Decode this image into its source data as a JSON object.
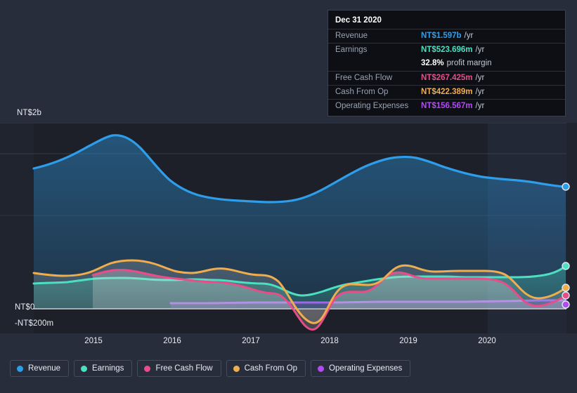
{
  "axes": {
    "y_top_label": "NT$2b",
    "y_zero_label": "NT$0",
    "y_neg_label": "-NT$200m",
    "x_labels": [
      "2015",
      "2016",
      "2017",
      "2018",
      "2019",
      "2020"
    ]
  },
  "tooltip": {
    "title": "Dec 31 2020",
    "rows": [
      {
        "key": "Revenue",
        "value": "NT$1.597b",
        "unit": "/yr",
        "color": "#2e9eeb"
      },
      {
        "key": "Earnings",
        "value": "NT$523.696m",
        "unit": "/yr",
        "color": "#4be0c0"
      },
      {
        "key": "",
        "value": "32.8%",
        "unit": "profit margin",
        "color": "#ffffff"
      },
      {
        "key": "Free Cash Flow",
        "value": "NT$267.425m",
        "unit": "/yr",
        "color": "#e84d8a"
      },
      {
        "key": "Cash From Op",
        "value": "NT$422.389m",
        "unit": "/yr",
        "color": "#f0ad4e"
      },
      {
        "key": "Operating Expenses",
        "value": "NT$156.567m",
        "unit": "/yr",
        "color": "#b24bf3"
      }
    ]
  },
  "legend": [
    {
      "label": "Revenue",
      "color": "#2e9eeb"
    },
    {
      "label": "Earnings",
      "color": "#4be0c0"
    },
    {
      "label": "Free Cash Flow",
      "color": "#e84d8a"
    },
    {
      "label": "Cash From Op",
      "color": "#f0ad4e"
    },
    {
      "label": "Operating Expenses",
      "color": "#b24bf3"
    }
  ],
  "chart_data": {
    "type": "area",
    "title": "Earnings and Revenue History",
    "xlabel": "",
    "ylabel": "NT$",
    "ylim": [
      -200000000,
      2000000000
    ],
    "grid": true,
    "legend_position": "bottom",
    "x_tick_labels": [
      "2015",
      "2016",
      "2017",
      "2018",
      "2019",
      "2020"
    ],
    "y_tick_labels": [
      "NT$2b",
      "NT$0",
      "-NT$200m"
    ],
    "annotation": "Dec 31 2020 tooltip: Revenue NT$1.597b/yr, Earnings NT$523.696m/yr (32.8% profit margin), Free Cash Flow NT$267.425m/yr, Cash From Op NT$422.389m/yr, Operating Expenses NT$156.567m/yr",
    "series": [
      {
        "name": "Revenue",
        "color": "#2e9eeb",
        "unit": "NT$",
        "points": [
          [
            2014.45,
            1510000000
          ],
          [
            2014.7,
            1570000000
          ],
          [
            2014.95,
            1680000000
          ],
          [
            2015.2,
            1800000000
          ],
          [
            2015.45,
            1880000000
          ],
          [
            2015.7,
            1860000000
          ],
          [
            2015.95,
            1780000000
          ],
          [
            2016.2,
            1660000000
          ],
          [
            2016.45,
            1560000000
          ],
          [
            2016.7,
            1490000000
          ],
          [
            2016.95,
            1450000000
          ],
          [
            2017.2,
            1420000000
          ],
          [
            2017.45,
            1400000000
          ],
          [
            2017.7,
            1400000000
          ],
          [
            2017.95,
            1430000000
          ],
          [
            2018.2,
            1500000000
          ],
          [
            2018.45,
            1580000000
          ],
          [
            2018.7,
            1640000000
          ],
          [
            2018.95,
            1650000000
          ],
          [
            2019.2,
            1630000000
          ],
          [
            2019.45,
            1600000000
          ],
          [
            2019.7,
            1580000000
          ],
          [
            2019.95,
            1570000000
          ],
          [
            2020.2,
            1570000000
          ],
          [
            2020.45,
            1555000000
          ],
          [
            2020.7,
            1570000000
          ],
          [
            2020.95,
            1597000000
          ]
        ],
        "final_value": 1597000000
      },
      {
        "name": "Earnings",
        "color": "#4be0c0",
        "unit": "NT$",
        "points": [
          [
            2014.45,
            390000000
          ],
          [
            2014.7,
            395000000
          ],
          [
            2014.95,
            405000000
          ],
          [
            2015.2,
            425000000
          ],
          [
            2015.45,
            440000000
          ],
          [
            2015.7,
            445000000
          ],
          [
            2015.95,
            440000000
          ],
          [
            2016.2,
            430000000
          ],
          [
            2016.45,
            420000000
          ],
          [
            2016.7,
            415000000
          ],
          [
            2016.95,
            415000000
          ],
          [
            2017.2,
            420000000
          ],
          [
            2017.45,
            415000000
          ],
          [
            2017.7,
            370000000
          ],
          [
            2017.95,
            350000000
          ],
          [
            2018.2,
            375000000
          ],
          [
            2018.45,
            420000000
          ],
          [
            2018.7,
            455000000
          ],
          [
            2018.95,
            470000000
          ],
          [
            2019.2,
            470000000
          ],
          [
            2019.45,
            465000000
          ],
          [
            2019.7,
            465000000
          ],
          [
            2019.95,
            465000000
          ],
          [
            2020.2,
            465000000
          ],
          [
            2020.45,
            470000000
          ],
          [
            2020.7,
            500000000
          ],
          [
            2020.95,
            523696000
          ]
        ],
        "final_value": 523696000
      },
      {
        "name": "Free Cash Flow",
        "color": "#e84d8a",
        "unit": "NT$",
        "points": [
          [
            2015.2,
            365000000
          ],
          [
            2015.45,
            400000000
          ],
          [
            2015.7,
            415000000
          ],
          [
            2015.95,
            410000000
          ],
          [
            2016.2,
            395000000
          ],
          [
            2016.45,
            375000000
          ],
          [
            2016.7,
            370000000
          ],
          [
            2016.95,
            370000000
          ],
          [
            2017.2,
            370000000
          ],
          [
            2017.45,
            330000000
          ],
          [
            2017.7,
            60000000
          ],
          [
            2017.85,
            -185000000
          ],
          [
            2018.05,
            75000000
          ],
          [
            2018.2,
            180000000
          ],
          [
            2018.45,
            185000000
          ],
          [
            2018.7,
            420000000
          ],
          [
            2018.85,
            300000000
          ],
          [
            2019.05,
            295000000
          ],
          [
            2019.3,
            360000000
          ],
          [
            2019.55,
            380000000
          ],
          [
            2019.8,
            355000000
          ],
          [
            2020.05,
            355000000
          ],
          [
            2020.3,
            370000000
          ],
          [
            2020.55,
            250000000
          ],
          [
            2020.75,
            180000000
          ],
          [
            2020.95,
            267425000
          ]
        ],
        "final_value": 267425000
      },
      {
        "name": "Cash From Op",
        "color": "#f0ad4e",
        "unit": "NT$",
        "points": [
          [
            2014.45,
            460000000
          ],
          [
            2014.7,
            445000000
          ],
          [
            2014.95,
            440000000
          ],
          [
            2015.2,
            445000000
          ],
          [
            2015.45,
            455000000
          ],
          [
            2015.7,
            520000000
          ],
          [
            2015.95,
            550000000
          ],
          [
            2016.2,
            545000000
          ],
          [
            2016.45,
            520000000
          ],
          [
            2016.7,
            480000000
          ],
          [
            2016.95,
            475000000
          ],
          [
            2017.2,
            485000000
          ],
          [
            2017.45,
            465000000
          ],
          [
            2017.7,
            300000000
          ],
          [
            2017.88,
            -150000000
          ],
          [
            2018.08,
            130000000
          ],
          [
            2018.25,
            235000000
          ],
          [
            2018.45,
            245000000
          ],
          [
            2018.7,
            500000000
          ],
          [
            2018.88,
            360000000
          ],
          [
            2019.08,
            365000000
          ],
          [
            2019.3,
            450000000
          ],
          [
            2019.55,
            470000000
          ],
          [
            2019.8,
            460000000
          ],
          [
            2020.05,
            460000000
          ],
          [
            2020.3,
            465000000
          ],
          [
            2020.55,
            330000000
          ],
          [
            2020.78,
            300000000
          ],
          [
            2020.95,
            422389000
          ]
        ],
        "final_value": 422389000
      },
      {
        "name": "Operating Expenses",
        "color": "#b24bf3",
        "unit": "NT$",
        "points": [
          [
            2016.2,
            48000000
          ],
          [
            2016.7,
            48000000
          ],
          [
            2017.2,
            50000000
          ],
          [
            2017.7,
            52000000
          ],
          [
            2018.2,
            55000000
          ],
          [
            2018.7,
            58000000
          ],
          [
            2019.2,
            60000000
          ],
          [
            2019.7,
            62000000
          ],
          [
            2020.2,
            64000000
          ],
          [
            2020.6,
            70000000
          ],
          [
            2020.95,
            156567000
          ]
        ],
        "final_value": 156567000
      }
    ]
  }
}
